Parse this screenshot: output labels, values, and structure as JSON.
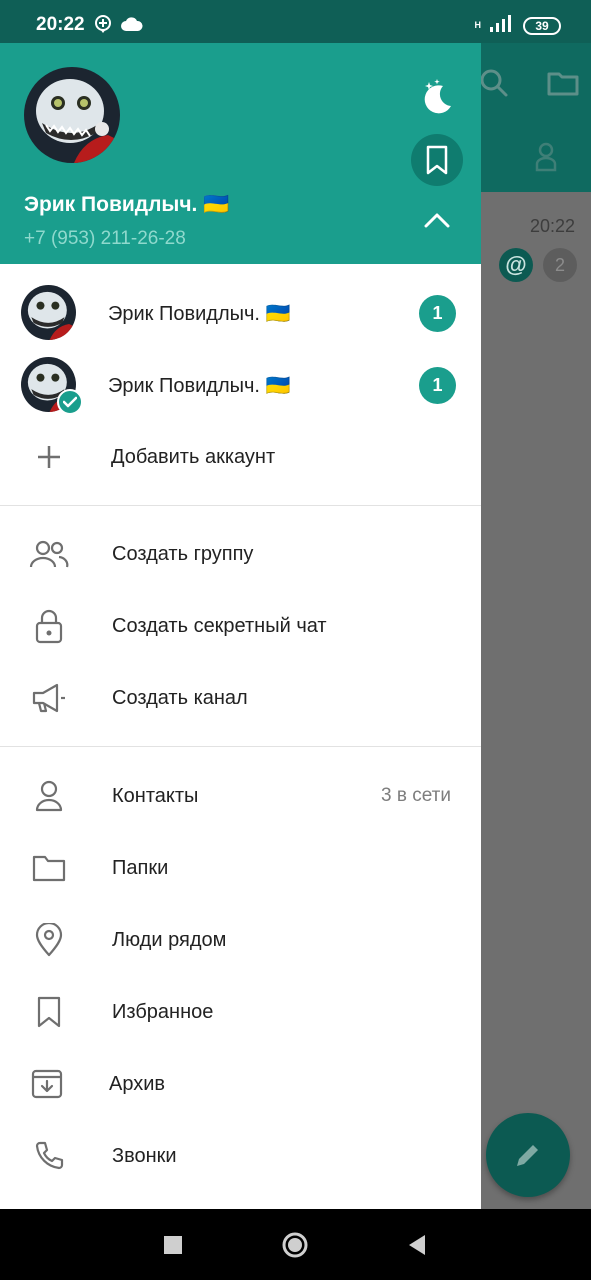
{
  "status_bar": {
    "time": "20:22",
    "network": "H",
    "battery": "39"
  },
  "background": {
    "chat_time": "20:22",
    "mention_badge": "@",
    "unread_count": "2"
  },
  "profile": {
    "name": "Эрик Повидлыч. 🇺🇦",
    "phone": "+7 (953) 211-26-28"
  },
  "accounts": [
    {
      "name": "Эрик Повидлыч. 🇺🇦",
      "badge": "1"
    },
    {
      "name": "Эрик Повидлыч. 🇺🇦",
      "badge": "1"
    }
  ],
  "add_account": {
    "label": "Добавить аккаунт"
  },
  "create_menu": [
    {
      "label": "Создать группу",
      "icon": "group-icon"
    },
    {
      "label": "Создать секретный чат",
      "icon": "lock-icon"
    },
    {
      "label": "Создать канал",
      "icon": "megaphone-icon"
    }
  ],
  "main_menu": [
    {
      "label": "Контакты",
      "icon": "person-icon",
      "value": "3 в сети"
    },
    {
      "label": "Папки",
      "icon": "folder-icon"
    },
    {
      "label": "Люди рядом",
      "icon": "location-pin-icon"
    },
    {
      "label": "Избранное",
      "icon": "bookmark-icon"
    },
    {
      "label": "Архив",
      "icon": "archive-icon"
    },
    {
      "label": "Звонки",
      "icon": "phone-icon"
    }
  ],
  "colors": {
    "accent": "#1a9e8d",
    "header_dark": "#128474",
    "text": "#222222",
    "muted": "#7d7d7d"
  }
}
